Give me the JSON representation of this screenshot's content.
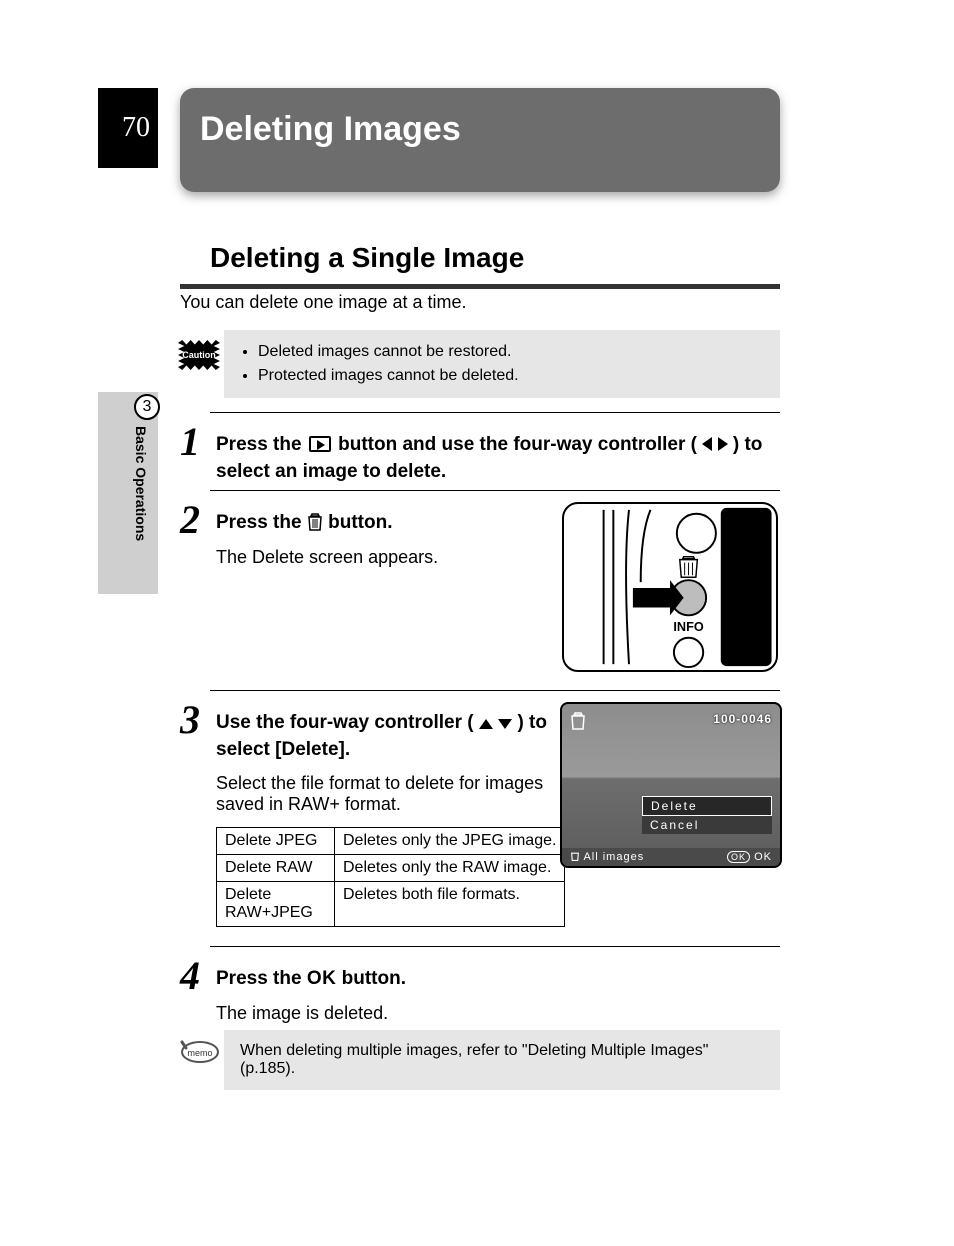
{
  "page_number": "70",
  "page_title": "Deleting Images",
  "sidebar": {
    "chapter_number": "3",
    "chapter_label": "Basic Operations"
  },
  "section_heading": "Deleting a Single Image",
  "intro_text": "You can delete one image at a time.",
  "caution": {
    "badge": "Caution",
    "items": [
      "Deleted images cannot be restored.",
      "Protected images cannot be deleted."
    ]
  },
  "steps": {
    "s1": {
      "num": "1",
      "head_before": "Press the ",
      "head_after_icon": " button and use the four-way controller (",
      "head_end": ") to select an image to delete."
    },
    "s2": {
      "num": "2",
      "head_before": "Press the ",
      "head_after": " button.",
      "desc": "The Delete screen appears.",
      "fig_info_label": "INFO"
    },
    "s3": {
      "num": "3",
      "head_before": "Use the four-way controller (",
      "head_after": ") to select [Delete].",
      "desc": "Select the file format to delete for images saved in RAW+ format.",
      "table": [
        {
          "k": "Delete JPEG",
          "v": "Deletes only the JPEG image."
        },
        {
          "k": "Delete RAW",
          "v": "Deletes only the RAW image."
        },
        {
          "k": "Delete RAW+JPEG",
          "v": "Deletes both file formats."
        }
      ],
      "lcd": {
        "file_number": "100-0046",
        "menu_delete": "Delete",
        "menu_cancel": "Cancel",
        "footer_left": "All images",
        "footer_right": "OK",
        "footer_ok_label": "OK"
      }
    },
    "s4": {
      "num": "4",
      "head_before": "Press the ",
      "head_ok": "OK",
      "head_after": " button.",
      "desc": "The image is deleted."
    }
  },
  "memo": {
    "badge": "memo",
    "text": "When deleting multiple images, refer to \"Deleting Multiple Images\" (p.185)."
  }
}
